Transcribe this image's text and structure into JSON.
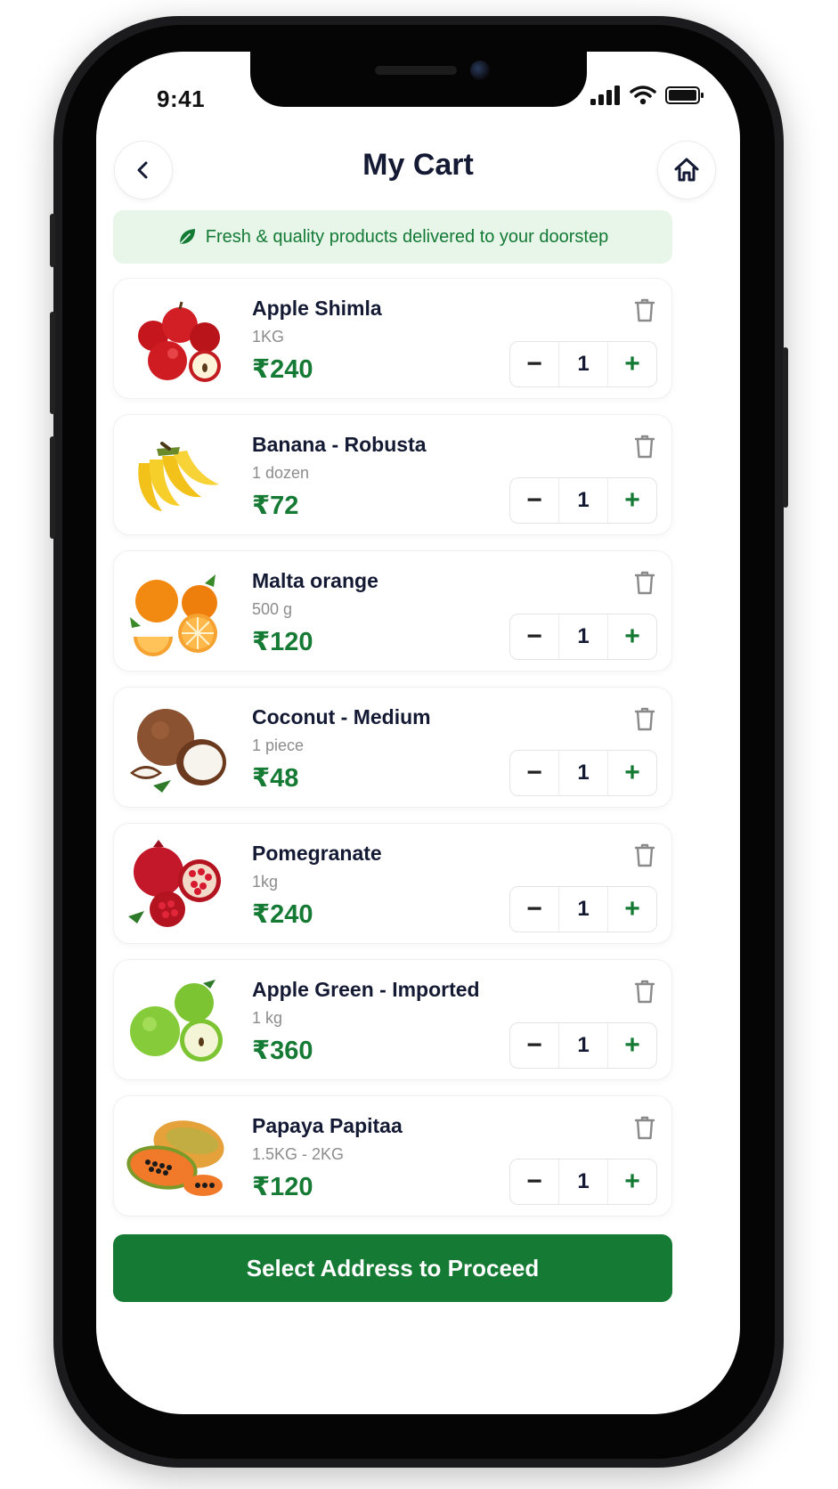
{
  "status_bar": {
    "time": "9:41"
  },
  "header": {
    "title": "My Cart"
  },
  "banner": {
    "text": "Fresh & quality products delivered to your doorstep"
  },
  "cart": {
    "items": [
      {
        "name": "Apple Shimla",
        "unit": "1KG",
        "price": "₹240",
        "qty": "1",
        "image": "red-apples"
      },
      {
        "name": "Banana - Robusta",
        "unit": "1 dozen",
        "price": "₹72",
        "qty": "1",
        "image": "bananas"
      },
      {
        "name": "Malta orange",
        "unit": "500 g",
        "price": "₹120",
        "qty": "1",
        "image": "oranges"
      },
      {
        "name": "Coconut - Medium",
        "unit": "1 piece",
        "price": "₹48",
        "qty": "1",
        "image": "coconut"
      },
      {
        "name": "Pomegranate",
        "unit": "1kg",
        "price": "₹240",
        "qty": "1",
        "image": "pomegranate"
      },
      {
        "name": "Apple Green - Imported",
        "unit": "1 kg",
        "price": "₹360",
        "qty": "1",
        "image": "green-apples"
      },
      {
        "name": "Papaya Papitaa",
        "unit": "1.5KG - 2KG",
        "price": "₹120",
        "qty": "1",
        "image": "papaya"
      }
    ],
    "minus_label": "−",
    "plus_label": "+"
  },
  "cta": {
    "label": "Select Address to Proceed"
  },
  "colors": {
    "brand_green": "#157a33",
    "banner_bg": "#e8f6ea",
    "title": "#141a33"
  }
}
